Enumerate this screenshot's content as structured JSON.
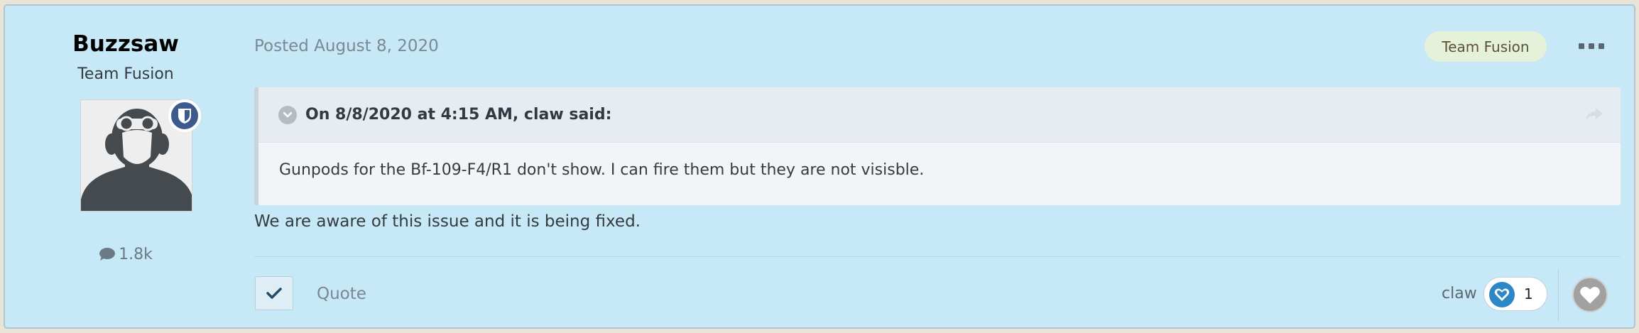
{
  "author": {
    "name": "Buzzsaw",
    "group": "Team Fusion",
    "post_count": "1.8k"
  },
  "post": {
    "posted": "Posted August 8, 2020",
    "group_badge": "Team Fusion",
    "quote": {
      "citation": "On 8/8/2020 at 4:15 AM, claw said:",
      "text": "Gunpods for the Bf-109-F4/R1 don't show. I can fire them but they are not visisble."
    },
    "body": "We are aware of this issue and it is being fixed."
  },
  "footer": {
    "quote_label": "Quote",
    "reacted_by": "claw",
    "reaction_count": "1"
  },
  "colors": {
    "post_background": "#c6e8f7",
    "badge_blue": "#3c5a8e",
    "reaction_blue": "#2d86c5"
  }
}
